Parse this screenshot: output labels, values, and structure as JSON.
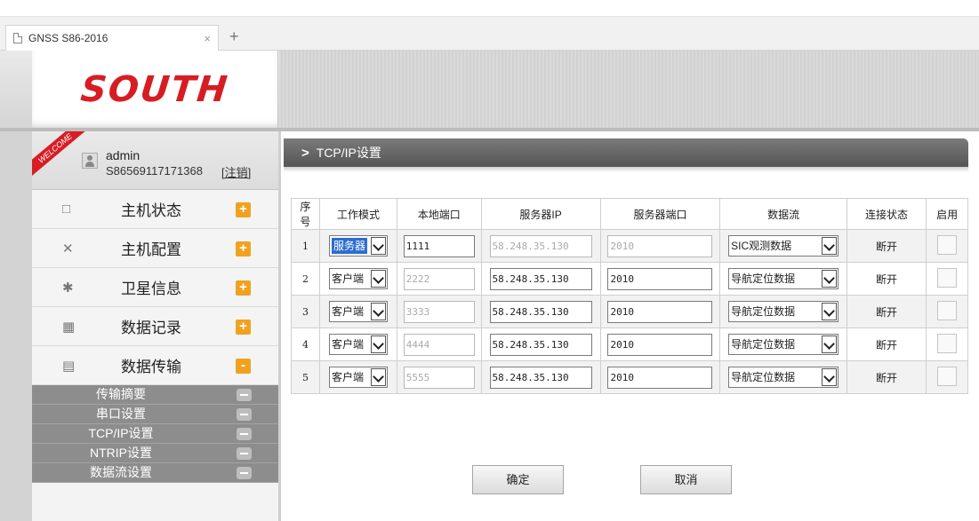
{
  "browser": {
    "tab_title": "GNSS S86-2016",
    "tab_close": "×",
    "new_tab": "+"
  },
  "header": {
    "logo_text": "SOUTH",
    "brand_color": "#d71d24"
  },
  "user": {
    "welcome": "WELCOME",
    "name": "admin",
    "serial": "S86569117171368",
    "logout": "[注销]"
  },
  "menu": {
    "items": [
      {
        "label": "主机状态",
        "icon": "monitor-icon",
        "toggle": "+"
      },
      {
        "label": "主机配置",
        "icon": "tools-icon",
        "toggle": "+"
      },
      {
        "label": "卫星信息",
        "icon": "satellite-icon",
        "toggle": "+"
      },
      {
        "label": "数据记录",
        "icon": "calendar-icon",
        "toggle": "+"
      },
      {
        "label": "数据传输",
        "icon": "network-icon",
        "toggle": "-"
      }
    ],
    "subitems": [
      {
        "label": "传输摘要"
      },
      {
        "label": "串口设置"
      },
      {
        "label": "TCP/IP设置"
      },
      {
        "label": "NTRIP设置"
      },
      {
        "label": "数据流设置"
      }
    ]
  },
  "section": {
    "title": "TCP/IP设置"
  },
  "table": {
    "headers": [
      "序号",
      "工作模式",
      "本地端口",
      "服务器IP",
      "服务器端口",
      "数据流",
      "连接状态",
      "启用"
    ],
    "rows": [
      {
        "index": "1",
        "mode": "服务器",
        "local_port": "1111",
        "server_ip": "58.248.35.130",
        "server_port": "2010",
        "stream": "SIC观测数据",
        "status": "断开"
      },
      {
        "index": "2",
        "mode": "客户端",
        "local_port": "2222",
        "server_ip": "58.248.35.130",
        "server_port": "2010",
        "stream": "导航定位数据",
        "status": "断开"
      },
      {
        "index": "3",
        "mode": "客户端",
        "local_port": "3333",
        "server_ip": "58.248.35.130",
        "server_port": "2010",
        "stream": "导航定位数据",
        "status": "断开"
      },
      {
        "index": "4",
        "mode": "客户端",
        "local_port": "4444",
        "server_ip": "58.248.35.130",
        "server_port": "2010",
        "stream": "导航定位数据",
        "status": "断开"
      },
      {
        "index": "5",
        "mode": "客户端",
        "local_port": "5555",
        "server_ip": "58.248.35.130",
        "server_port": "2010",
        "stream": "导航定位数据",
        "status": "断开"
      }
    ]
  },
  "buttons": {
    "confirm": "确定",
    "cancel": "取消"
  }
}
